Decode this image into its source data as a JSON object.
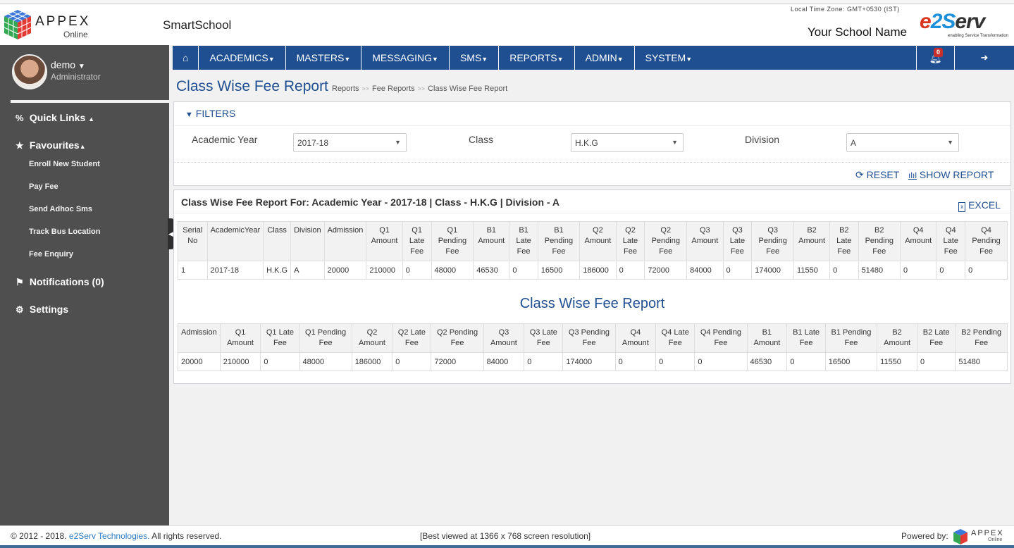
{
  "header": {
    "logo_text": "APPEX",
    "logo_sub": "Online",
    "app_name": "SmartSchool",
    "timezone": "Local Time Zone: GMT+0530 (IST)",
    "school_name": "Your School Name",
    "brand_e": "e",
    "brand_2": "2S",
    "brand_rest": "erv",
    "brand_tag": "enabling Service Transformation"
  },
  "user": {
    "name": "demo",
    "role": "Administrator"
  },
  "sidebar": {
    "quick_links": "Quick Links",
    "favourites": "Favourites",
    "favourite_items": [
      "Enroll New Student",
      "Pay Fee",
      "Send Adhoc Sms",
      "Track Bus Location",
      "Fee Enquiry"
    ],
    "notifications": "Notifications (0)",
    "settings": "Settings"
  },
  "navbar": {
    "items": [
      "ACADEMICS",
      "MASTERS",
      "MESSAGING",
      "SMS",
      "REPORTS",
      "ADMIN",
      "SYSTEM"
    ],
    "notification_count": "0"
  },
  "page": {
    "title": "Class Wise Fee Report",
    "breadcrumb": [
      "Reports",
      "Fee Reports",
      "Class Wise Fee Report"
    ]
  },
  "filters": {
    "heading": "FILTERS",
    "academic_year_label": "Academic Year",
    "academic_year_value": "2017-18",
    "class_label": "Class",
    "class_value": "H.K.G",
    "division_label": "Division",
    "division_value": "A",
    "reset_label": "RESET",
    "show_report_label": "SHOW REPORT"
  },
  "report": {
    "title": "Class Wise Fee Report For: Academic Year - 2017-18 | Class - H.K.G | Division - A",
    "excel_label": "EXCEL",
    "table1": {
      "headers": [
        "Serial No",
        "AcademicYear",
        "Class",
        "Division",
        "Admission",
        "Q1 Amount",
        "Q1 Late Fee",
        "Q1 Pending Fee",
        "B1 Amount",
        "B1 Late Fee",
        "B1 Pending Fee",
        "Q2 Amount",
        "Q2 Late Fee",
        "Q2 Pending Fee",
        "Q3 Amount",
        "Q3 Late Fee",
        "Q3 Pending Fee",
        "B2 Amount",
        "B2 Late Fee",
        "B2 Pending Fee",
        "Q4 Amount",
        "Q4 Late Fee",
        "Q4 Pending Fee"
      ],
      "rows": [
        [
          "1",
          "2017-18",
          "H.K.G",
          "A",
          "20000",
          "210000",
          "0",
          "48000",
          "46530",
          "0",
          "16500",
          "186000",
          "0",
          "72000",
          "84000",
          "0",
          "174000",
          "11550",
          "0",
          "51480",
          "0",
          "0",
          "0"
        ]
      ]
    },
    "table2_title": "Class Wise Fee Report",
    "table2": {
      "headers": [
        "Admission",
        "Q1 Amount",
        "Q1 Late Fee",
        "Q1 Pending Fee",
        "Q2 Amount",
        "Q2 Late Fee",
        "Q2 Pending Fee",
        "Q3 Amount",
        "Q3 Late Fee",
        "Q3 Pending Fee",
        "Q4 Amount",
        "Q4 Late Fee",
        "Q4 Pending Fee",
        "B1 Amount",
        "B1 Late Fee",
        "B1 Pending Fee",
        "B2 Amount",
        "B2 Late Fee",
        "B2 Pending Fee"
      ],
      "rows": [
        [
          "20000",
          "210000",
          "0",
          "48000",
          "186000",
          "0",
          "72000",
          "84000",
          "0",
          "174000",
          "0",
          "0",
          "0",
          "46530",
          "0",
          "16500",
          "11550",
          "0",
          "51480"
        ]
      ]
    }
  },
  "footer": {
    "copyright_prefix": "© 2012 - 2018.",
    "company_link": "e2Serv Technologies.",
    "copyright_suffix": "All rights reserved.",
    "resolution_note": "[Best viewed at 1366 x 768 screen resolution]",
    "powered_by": "Powered by:",
    "powered_logo": "APPEX",
    "powered_logo_sub": "Online"
  }
}
